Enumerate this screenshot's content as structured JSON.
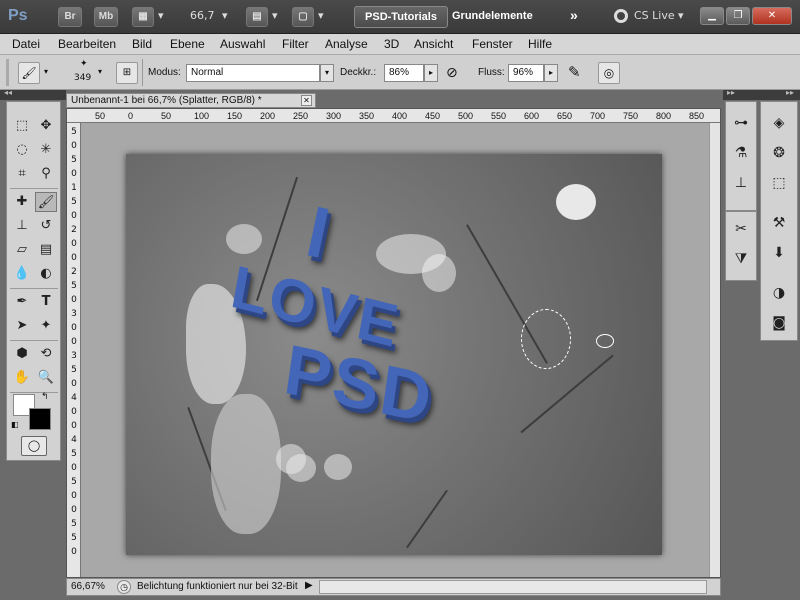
{
  "appbar": {
    "logo": "Ps",
    "bridge": "Br",
    "minibridge": "Mb",
    "zoom": "66,7",
    "workspace_active": "PSD-Tutorials",
    "workspace": "Grundelemente",
    "more": "»",
    "cslive": "CS Live"
  },
  "menu": [
    "Datei",
    "Bearbeiten",
    "Bild",
    "Ebene",
    "Auswahl",
    "Filter",
    "Analyse",
    "3D",
    "Ansicht",
    "Fenster",
    "Hilfe"
  ],
  "options": {
    "brush_size": "349",
    "mode_label": "Modus:",
    "mode_value": "Normal",
    "opacity_label": "Deckkr.:",
    "opacity_value": "86%",
    "flow_label": "Fluss:",
    "flow_value": "96%"
  },
  "document": {
    "tab_title": "Unbenannt-1 bei 66,7% (Splatter, RGB/8) *",
    "ruler_h": [
      "50",
      "0",
      "50",
      "100",
      "150",
      "200",
      "250",
      "300",
      "350",
      "400",
      "450",
      "500",
      "550",
      "600",
      "650",
      "700",
      "750",
      "800",
      "850"
    ],
    "ruler_v": [
      "5",
      "0",
      "5",
      "0",
      "1",
      "5",
      "0",
      "2",
      "0",
      "0",
      "2",
      "5",
      "0",
      "3",
      "0",
      "0",
      "3",
      "5",
      "0",
      "4",
      "0",
      "0",
      "4",
      "5",
      "0",
      "5",
      "0",
      "0",
      "5",
      "5",
      "0"
    ],
    "artwork_text": [
      "I",
      "LOVE",
      "PSD"
    ]
  },
  "status": {
    "zoom": "66,67%",
    "info": "Belichtung funktioniert nur bei 32-Bit"
  },
  "colors": {
    "highlight": "#e21c1c",
    "letters": "#4466b8"
  }
}
